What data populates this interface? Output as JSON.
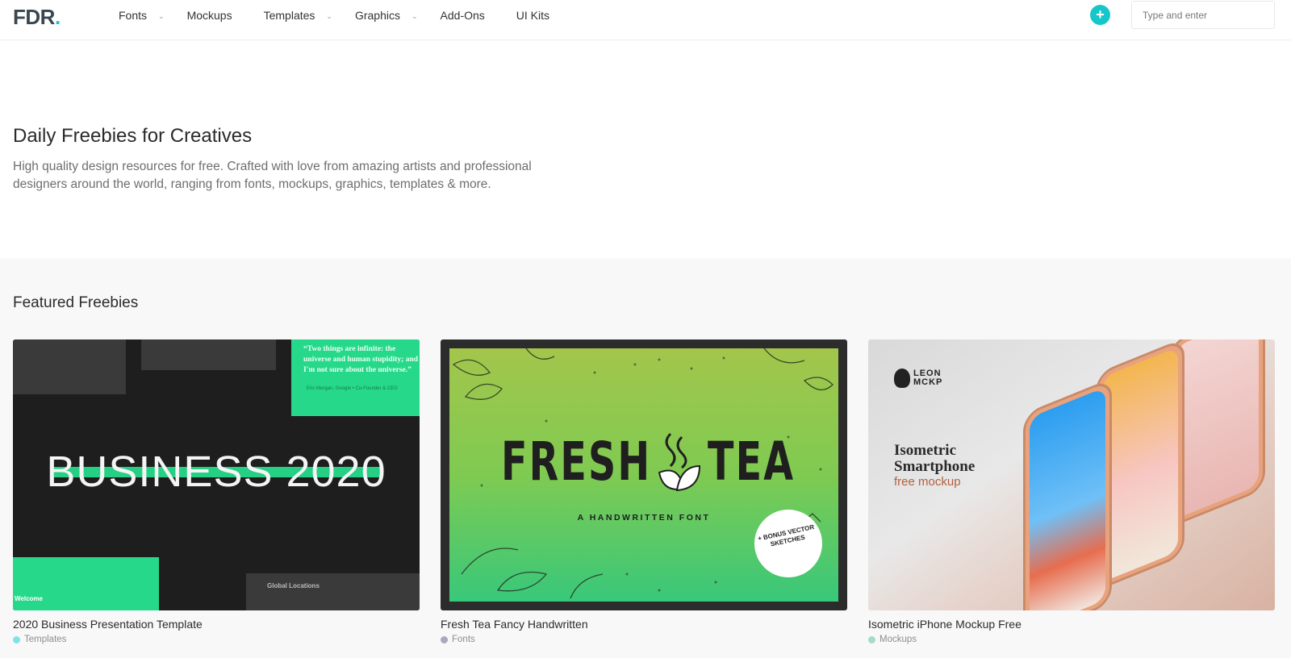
{
  "header": {
    "logo_text": "FDR",
    "logo_dot": ".",
    "nav": [
      {
        "label": "Fonts",
        "has_dropdown": true
      },
      {
        "label": "Mockups",
        "has_dropdown": false
      },
      {
        "label": "Templates",
        "has_dropdown": true
      },
      {
        "label": "Graphics",
        "has_dropdown": true
      },
      {
        "label": "Add-Ons",
        "has_dropdown": false
      },
      {
        "label": "UI Kits",
        "has_dropdown": false
      }
    ],
    "plus_icon": "+",
    "search_placeholder": "Type and enter"
  },
  "hero": {
    "title": "Daily Freebies for Creatives",
    "description": "High quality design resources for free. Crafted with love from amazing artists and professional designers around the world, ranging from fonts, mockups, graphics, templates & more."
  },
  "featured": {
    "title": "Featured Freebies",
    "cards": [
      {
        "title": "2020 Business Presentation Template",
        "category": "Templates",
        "category_color": "#7fe3e6",
        "thumb": {
          "quote": "“Two things are infinite: the universe and human stupidity; and I'm not sure about the universe.”",
          "quote_by": "Eric Morgan, Google • Co-Founder & CEO",
          "headline": "BUSINESS 2020",
          "welcome": "Welcome",
          "global": "Global Locations"
        }
      },
      {
        "title": "Fresh Tea Fancy Handwritten",
        "category": "Fonts",
        "category_color": "#a7a9bf",
        "thumb": {
          "word_left": "FRESH",
          "word_right": "TEA",
          "subtitle": "A HANDWRITTEN FONT",
          "badge": "+ BONUS VECTOR SKETCHES"
        }
      },
      {
        "title": "Isometric iPhone Mockup Free",
        "category": "Mockups",
        "category_color": "#a6dcc6",
        "thumb": {
          "brand_line1": "LEON",
          "brand_line2": "MCKP",
          "heading": "Isometric Smartphone",
          "subheading": "free mockup"
        }
      }
    ]
  }
}
